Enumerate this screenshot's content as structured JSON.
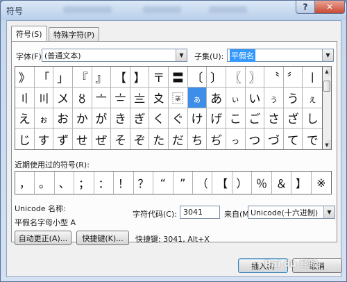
{
  "window": {
    "title": "符号"
  },
  "tabs": [
    {
      "label": "符号(S)"
    },
    {
      "label": "特殊字符(P)"
    }
  ],
  "font": {
    "label": "字体(F):",
    "value": "(普通文本)"
  },
  "subset": {
    "label": "子集(U):",
    "value": "平假名"
  },
  "symbol_grid": [
    [
      "》",
      "「",
      "」",
      "『",
      "』",
      "【",
      "】",
      "〒",
      "〓",
      "〔",
      "〕",
      "〖",
      "〗",
      "〝",
      "〞",
      "〡"
    ],
    [
      "〢",
      "〣",
      "〤",
      "〥",
      "〦",
      "〧",
      "〨",
      "〩",
      "〾",
      "ぁ",
      "あ",
      "ぃ",
      "い",
      "ぅ",
      "う",
      "ぇ"
    ],
    [
      "え",
      "ぉ",
      "お",
      "か",
      "が",
      "き",
      "ぎ",
      "く",
      "ぐ",
      "け",
      "げ",
      "こ",
      "ご",
      "さ",
      "ざ",
      "し"
    ],
    [
      "じ",
      "す",
      "ず",
      "せ",
      "ぜ",
      "そ",
      "ぞ",
      "た",
      "だ",
      "ち",
      "ぢ",
      "っ",
      "つ",
      "づ",
      "て",
      "で"
    ]
  ],
  "recent": {
    "label": "近期使用过的符号(R):",
    "symbols": [
      "，",
      "。",
      "、",
      "；",
      "：",
      "！",
      "？",
      "“",
      "”",
      "（",
      "【",
      "）",
      "％",
      "＆",
      "】",
      "※"
    ]
  },
  "unicode_name": {
    "label": "Unicode 名称:",
    "value": "平假名字母小型 A"
  },
  "char_code": {
    "label": "字符代码(C):",
    "value": "3041"
  },
  "from": {
    "label": "来自(M):",
    "value": "Unicode(十六进制)"
  },
  "buttons": {
    "autocorrect": "自动更正(A)...",
    "shortcut_key": "快捷键(K)...",
    "insert": "插入(I)",
    "cancel": "取消"
  },
  "shortcut_info": "快捷键: 3041, Alt+X",
  "watermark": "Bai du 经验"
}
